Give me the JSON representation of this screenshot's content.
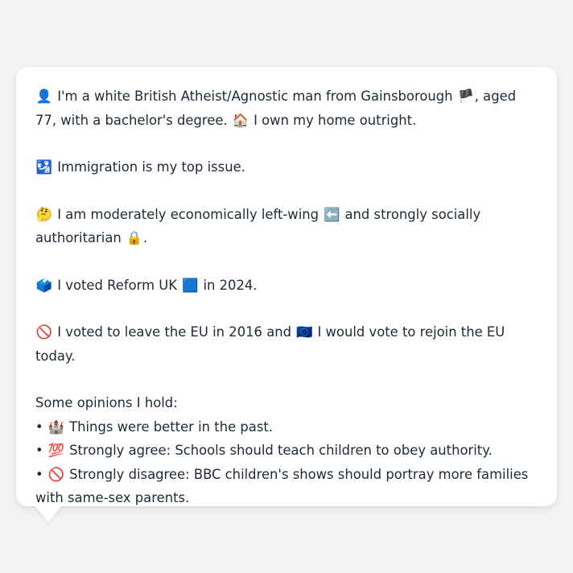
{
  "profile": {
    "intro": {
      "icon": "bust-icon",
      "emoji": "👤",
      "text_a": " I'm a white British Atheist/Agnostic man from Gainsborough ",
      "flag_icon": "england-flag-icon",
      "flag_emoji": "🏴",
      "text_b": ", aged 77, with a bachelor's degree. ",
      "home_icon": "house-icon",
      "home_emoji": "🏠",
      "text_c": " I own my home outright."
    },
    "issue": {
      "icon": "passport-control-icon",
      "emoji": "🛂",
      "text": " Immigration is my top issue."
    },
    "ideology": {
      "icon": "thinking-face-icon",
      "emoji": "🤔",
      "text_a": " I am moderately economically left-wing ",
      "left_icon": "left-arrow-icon",
      "left_emoji": "⬅️",
      "text_b": " and strongly socially authoritarian ",
      "lock_icon": "lock-icon",
      "lock_emoji": "🔒",
      "text_c": "."
    },
    "vote": {
      "icon": "ballot-box-icon",
      "emoji": "🗳️",
      "text_a": " I voted Reform UK ",
      "party_icon": "blue-square-icon",
      "party_emoji": "🟦",
      "text_b": " in 2024."
    },
    "eu": {
      "icon": "prohibited-icon",
      "emoji": "🚫",
      "text_a": " I voted to leave the EU in 2016 and ",
      "eu_icon": "eu-flag-icon",
      "eu_emoji": "🇪🇺",
      "text_b": " I would vote to rejoin the EU today."
    },
    "opinions": {
      "heading": "Some opinions I hold:",
      "items": [
        {
          "bullet": "•",
          "icon": "castle-icon",
          "emoji": "🏰",
          "text": " Things were better in the past."
        },
        {
          "bullet": "•",
          "icon": "hundred-points-icon",
          "emoji": "💯",
          "text": " Strongly agree: Schools should teach children to obey authority."
        },
        {
          "bullet": "•",
          "icon": "prohibited-icon",
          "emoji": "🚫",
          "text": " Strongly disagree: BBC children's shows should portray more families with same-sex parents."
        }
      ]
    }
  },
  "colors": {
    "background": "#f3f4f6",
    "card": "#ffffff",
    "text": "#1f2937"
  }
}
